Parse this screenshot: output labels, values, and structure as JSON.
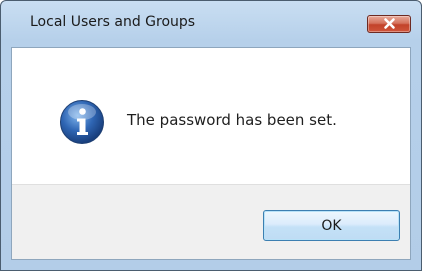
{
  "window": {
    "title": "Local Users and Groups",
    "close_icon": "close-icon"
  },
  "dialog": {
    "icon": "info-icon",
    "message": "The password has been set.",
    "ok_label": "OK"
  },
  "colors": {
    "titlebar": "#b9d1ea",
    "close_button": "#c7452c",
    "info_icon": "#2a5ea8",
    "ok_button_border": "#3c7fb1"
  }
}
